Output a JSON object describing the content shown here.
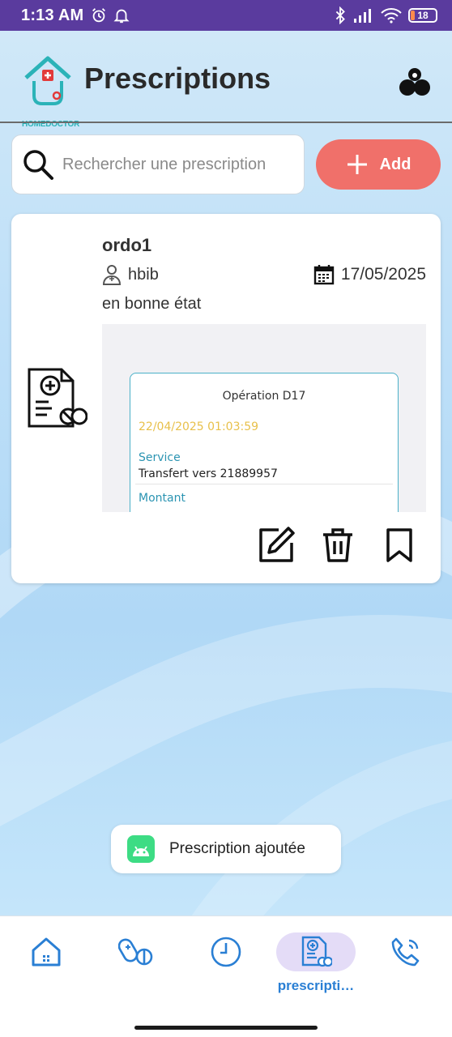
{
  "status_bar": {
    "time": "1:13 AM",
    "battery": "18"
  },
  "header": {
    "logo_text": "HOMEDOCTOR",
    "title": "Prescriptions"
  },
  "search": {
    "placeholder": "Rechercher une prescription"
  },
  "add_button": {
    "label": "Add"
  },
  "prescriptions": [
    {
      "title": "ordo1",
      "doctor": "hbib",
      "date": "17/05/2025",
      "description": "en bonne état",
      "image": {
        "heading": "Opération D17",
        "datetime": "22/04/2025 01:03:59",
        "service_label": "Service",
        "service_value": "Transfert vers 21889957",
        "amount_label": "Montant"
      }
    }
  ],
  "toast": {
    "message": "Prescription ajoutée"
  },
  "bottom_nav": {
    "items": [
      {
        "icon": "home-icon"
      },
      {
        "icon": "pills-icon"
      },
      {
        "icon": "clock-icon"
      },
      {
        "icon": "prescription-icon",
        "label": "prescripti…"
      },
      {
        "icon": "phone-icon"
      }
    ],
    "active_index": 3
  },
  "colors": {
    "status_bar": "#5a3b9e",
    "accent": "#f0706a",
    "nav_blue": "#2a7fd4",
    "active_pill": "#e4dcf7"
  }
}
